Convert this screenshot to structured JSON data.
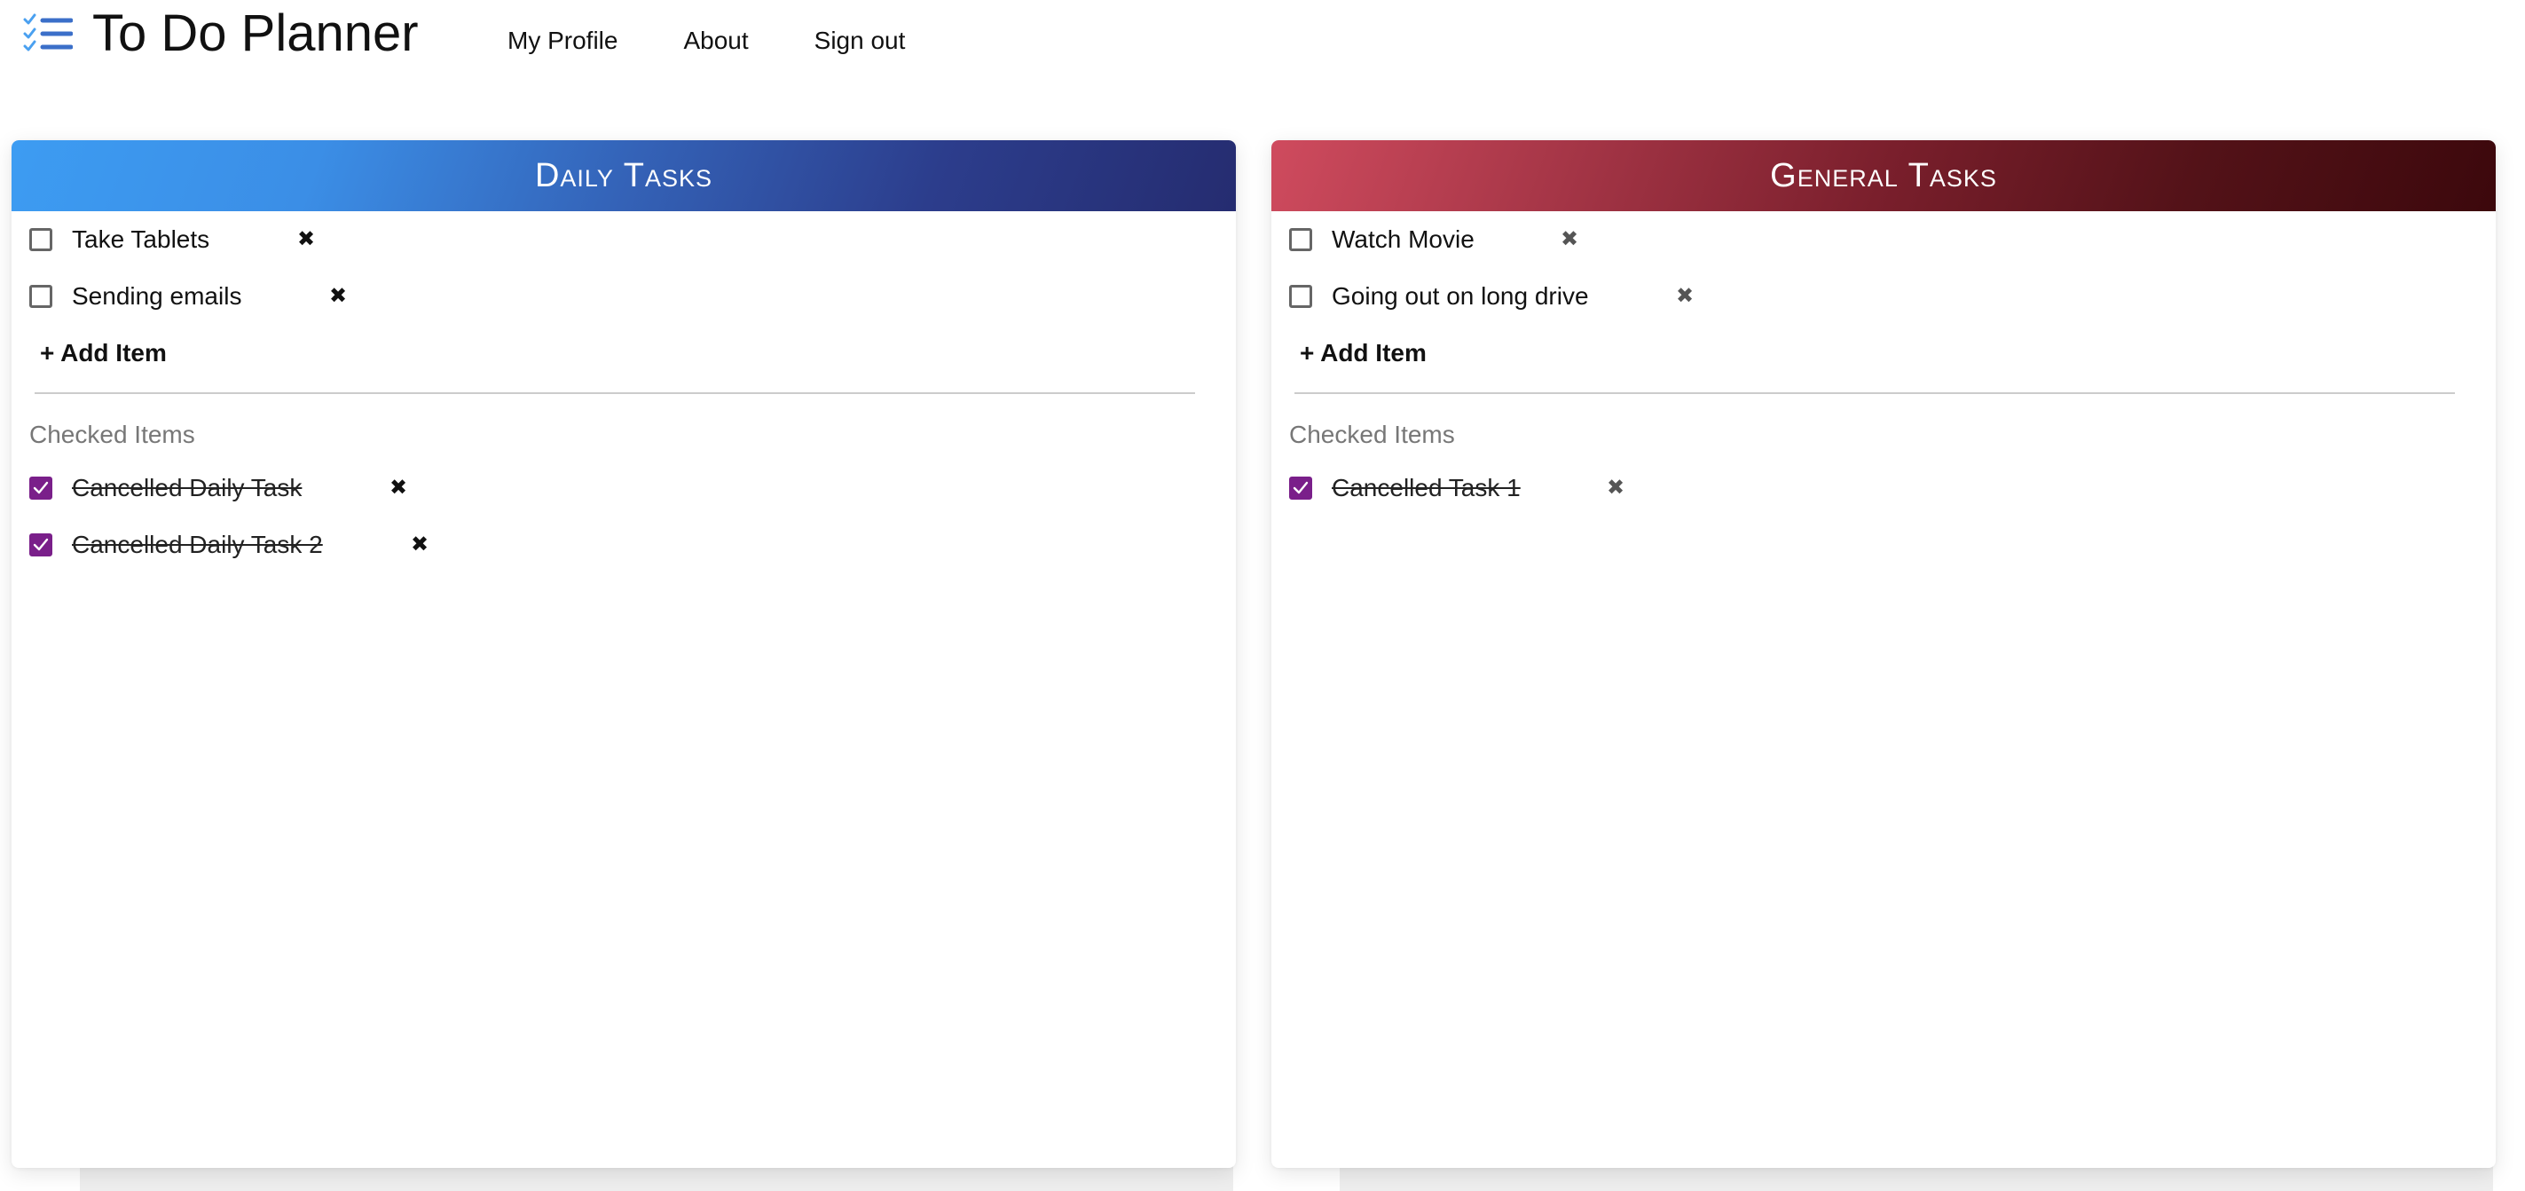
{
  "app": {
    "title": "To Do Planner"
  },
  "nav": {
    "items": [
      "My Profile",
      "About",
      "Sign out"
    ]
  },
  "colors": {
    "accent_logo": "#3b6fc9",
    "checked_box": "#7a1f8a",
    "daily_gradient": [
      "#3d9cf2",
      "#252c70"
    ],
    "general_gradient": [
      "#cf4b5e",
      "#3c080c"
    ]
  },
  "panels": [
    {
      "title": "Daily Tasks",
      "tasks": [
        "Take Tablets",
        "Sending emails"
      ],
      "add_label": "+ Add Item",
      "checked_heading": "Checked Items",
      "checked_tasks": [
        "Cancelled Daily Task",
        "Cancelled Daily Task 2"
      ],
      "delete_icon": "close-x-icon"
    },
    {
      "title": "General Tasks",
      "tasks": [
        "Watch Movie",
        "Going out on long drive"
      ],
      "add_label": "+ Add Item",
      "checked_heading": "Checked Items",
      "checked_tasks": [
        "Cancelled Task 1"
      ],
      "delete_icon": "close-x-icon"
    }
  ]
}
